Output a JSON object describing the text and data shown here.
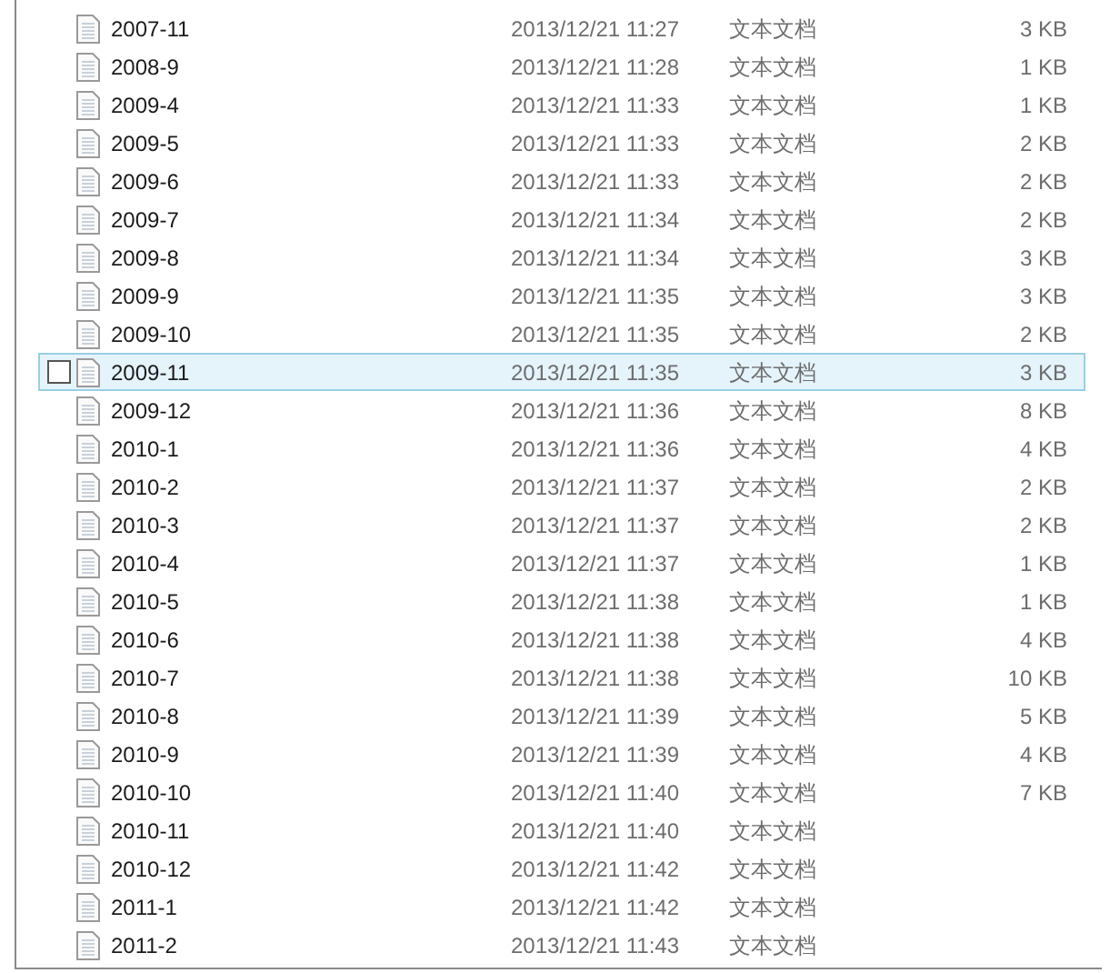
{
  "files": [
    {
      "name": "2007-11",
      "modified": "2013/12/21 11:27",
      "type": "文本文档",
      "size": "3 KB",
      "selected": false
    },
    {
      "name": "2008-9",
      "modified": "2013/12/21 11:28",
      "type": "文本文档",
      "size": "1 KB",
      "selected": false
    },
    {
      "name": "2009-4",
      "modified": "2013/12/21 11:33",
      "type": "文本文档",
      "size": "1 KB",
      "selected": false
    },
    {
      "name": "2009-5",
      "modified": "2013/12/21 11:33",
      "type": "文本文档",
      "size": "2 KB",
      "selected": false
    },
    {
      "name": "2009-6",
      "modified": "2013/12/21 11:33",
      "type": "文本文档",
      "size": "2 KB",
      "selected": false
    },
    {
      "name": "2009-7",
      "modified": "2013/12/21 11:34",
      "type": "文本文档",
      "size": "2 KB",
      "selected": false
    },
    {
      "name": "2009-8",
      "modified": "2013/12/21 11:34",
      "type": "文本文档",
      "size": "3 KB",
      "selected": false
    },
    {
      "name": "2009-9",
      "modified": "2013/12/21 11:35",
      "type": "文本文档",
      "size": "3 KB",
      "selected": false
    },
    {
      "name": "2009-10",
      "modified": "2013/12/21 11:35",
      "type": "文本文档",
      "size": "2 KB",
      "selected": false
    },
    {
      "name": "2009-11",
      "modified": "2013/12/21 11:35",
      "type": "文本文档",
      "size": "3 KB",
      "selected": true
    },
    {
      "name": "2009-12",
      "modified": "2013/12/21 11:36",
      "type": "文本文档",
      "size": "8 KB",
      "selected": false
    },
    {
      "name": "2010-1",
      "modified": "2013/12/21 11:36",
      "type": "文本文档",
      "size": "4 KB",
      "selected": false
    },
    {
      "name": "2010-2",
      "modified": "2013/12/21 11:37",
      "type": "文本文档",
      "size": "2 KB",
      "selected": false
    },
    {
      "name": "2010-3",
      "modified": "2013/12/21 11:37",
      "type": "文本文档",
      "size": "2 KB",
      "selected": false
    },
    {
      "name": "2010-4",
      "modified": "2013/12/21 11:37",
      "type": "文本文档",
      "size": "1 KB",
      "selected": false
    },
    {
      "name": "2010-5",
      "modified": "2013/12/21 11:38",
      "type": "文本文档",
      "size": "1 KB",
      "selected": false
    },
    {
      "name": "2010-6",
      "modified": "2013/12/21 11:38",
      "type": "文本文档",
      "size": "4 KB",
      "selected": false
    },
    {
      "name": "2010-7",
      "modified": "2013/12/21 11:38",
      "type": "文本文档",
      "size": "10 KB",
      "selected": false
    },
    {
      "name": "2010-8",
      "modified": "2013/12/21 11:39",
      "type": "文本文档",
      "size": "5 KB",
      "selected": false
    },
    {
      "name": "2010-9",
      "modified": "2013/12/21 11:39",
      "type": "文本文档",
      "size": "4 KB",
      "selected": false
    },
    {
      "name": "2010-10",
      "modified": "2013/12/21 11:40",
      "type": "文本文档",
      "size": "7 KB",
      "selected": false
    },
    {
      "name": "2010-11",
      "modified": "2013/12/21 11:40",
      "type": "文本文档",
      "selected": false
    },
    {
      "name": "2010-12",
      "modified": "2013/12/21 11:42",
      "type": "文本文档",
      "selected": false
    },
    {
      "name": "2011-1",
      "modified": "2013/12/21 11:42",
      "type": "文本文档",
      "selected": false
    },
    {
      "name": "2011-2",
      "modified": "2013/12/21 11:43",
      "type": "文本文档",
      "selected": false
    }
  ]
}
